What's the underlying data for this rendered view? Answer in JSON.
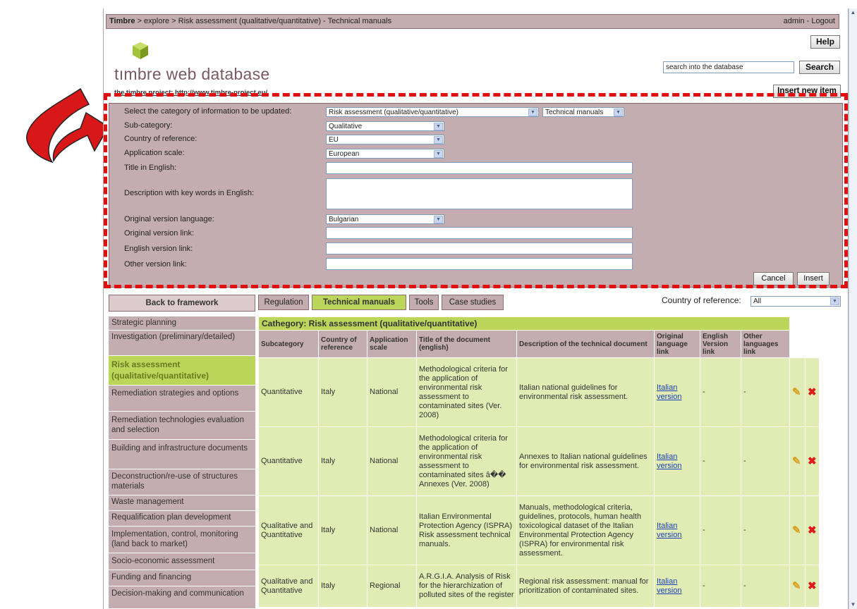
{
  "breadcrumb": {
    "root": "Timbre",
    "path": " > explore > Risk assessment (qualitative/quantitative) - Technical manuals",
    "user": "admin - Logout"
  },
  "header": {
    "logo_text": "tımbre web database",
    "project_text": "the timbre project: http://www.timbre-project.eu/",
    "help_label": "Help",
    "search_value": "search into the database",
    "search_label": "Search",
    "insert_new_label": "Insert new item"
  },
  "form": {
    "category_label": "Select the category of information to be updated:",
    "category_value": "Risk assessment (qualitative/quantitative)",
    "type_value": "Technical manuals",
    "subcategory_label": "Sub-category:",
    "subcategory_value": "Qualitative",
    "country_label": "Country of reference:",
    "country_value": "EU",
    "scale_label": "Application scale:",
    "scale_value": "European",
    "title_label": "Title in English:",
    "title_value": "",
    "desc_label": "Description with key words in English:",
    "desc_value": "",
    "lang_label": "Original version language:",
    "lang_value": "Bulgarian",
    "orig_link_label": "Original version link:",
    "orig_link_value": "",
    "en_link_label": "English version link:",
    "en_link_value": "",
    "other_link_label": "Other version link:",
    "other_link_value": "",
    "cancel_label": "Cancel",
    "insert_label": "Insert"
  },
  "tabs": {
    "back_label": "Back to framework",
    "items": [
      "Regulation",
      "Technical manuals",
      "Tools",
      "Case studies"
    ],
    "country_filter_label": "Country of reference:",
    "country_filter_value": "All"
  },
  "sidebar": {
    "items": [
      "Strategic planning",
      "Investigation (preliminary/detailed)",
      "Risk assessment (qualitative/quantitative)",
      "Remediation strategies and options",
      "Remediation technologies evaluation and selection",
      "Building and infrastructure documents",
      "Deconstruction/re-use of structures materials",
      "Waste management",
      "Requalification plan development",
      "Implementation, control, monitoring (land back to market)",
      "Socio-economic assessment",
      "Funding and financing",
      "Decision-making and communication"
    ]
  },
  "table": {
    "category_caption": "Cathegory: Risk assessment (qualitative/quantitative)",
    "columns": [
      "Subcategory",
      "Country of reference",
      "Application scale",
      "Title of the document (english)",
      "Description of the technical document",
      "Original language link",
      "English Version link",
      "Other languages link"
    ],
    "rows": [
      {
        "subcategory": "Quantitative",
        "country": "Italy",
        "scale": "National",
        "title": "Methodological criteria for the application of environmental risk assessment to contaminated sites (Ver. 2008)",
        "description": "Italian national guidelines for environmental risk assessment.",
        "orig_link": "Italian version",
        "en_link": "-",
        "other_link": "-"
      },
      {
        "subcategory": "Quantitative",
        "country": "Italy",
        "scale": "National",
        "title": "Methodological criteria for the application of environmental risk assessment to contaminated sites â�� Annexes (Ver. 2008)",
        "description": "Annexes to Italian national guidelines for environmental risk assessment.",
        "orig_link": "Italian version",
        "en_link": "-",
        "other_link": "-"
      },
      {
        "subcategory": "Qualitative and Quantitative",
        "country": "Italy",
        "scale": "National",
        "title": "Italian Environmental Protection Agency (ISPRA) Risk assessment technical manuals.",
        "description": "Manuals, methodological criteria, guidelines, protocols, human health toxicological dataset of the Italian Environmental Protection Agency (ISPRA) for environmental risk assessment.",
        "orig_link": "Italian version",
        "en_link": "-",
        "other_link": "-"
      },
      {
        "subcategory": "Qualitative and Quantitative",
        "country": "Italy",
        "scale": "Regional",
        "title": "A.R.G.I.A. Analysis of Risk for the hierarchization of polluted sites of the register",
        "description": "Regional risk assessment: manual for prioritization of contaminated sites.",
        "orig_link": "Italian version",
        "en_link": "-",
        "other_link": "-"
      }
    ],
    "edit_glyph": "✎",
    "delete_glyph": "✖"
  },
  "colors": {
    "panel": "#c4adb0",
    "active_green": "#bbd65a",
    "row_green": "#e0ecb4",
    "dash_red": "#e01010",
    "arrow_red": "#d81818"
  }
}
